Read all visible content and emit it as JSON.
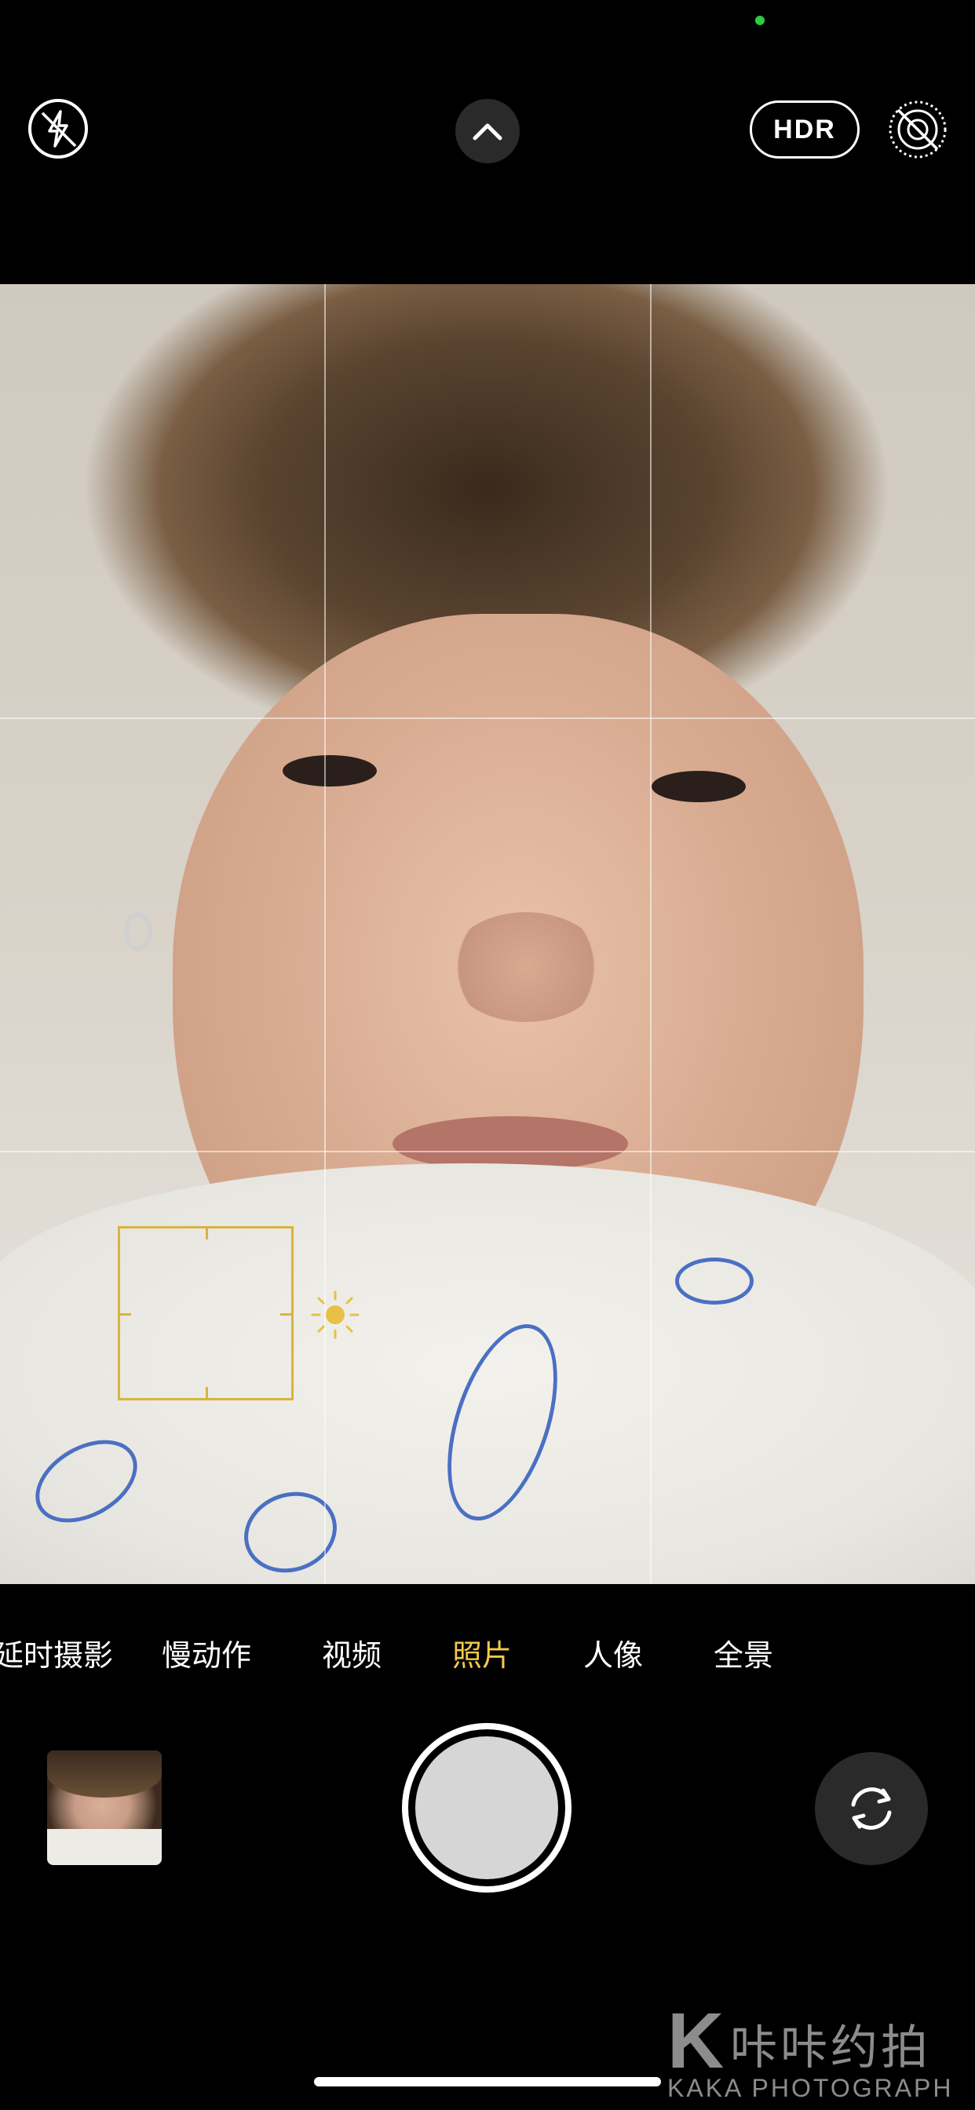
{
  "top_bar": {
    "flash_icon": "flash-off-icon",
    "expand_icon": "chevron-up-icon",
    "hdr_label": "HDR",
    "live_icon": "live-photo-off-icon"
  },
  "viewfinder": {
    "grid": true,
    "focus_color": "#d9b43c",
    "exposure_icon": "sun-icon"
  },
  "modes": {
    "items": [
      "延时摄影",
      "慢动作",
      "视频",
      "照片",
      "人像",
      "全景"
    ],
    "active": "照片",
    "active_color": "#f2c94c"
  },
  "bottom_bar": {
    "thumbnail_icon": "last-photo-thumbnail",
    "shutter_icon": "shutter-button",
    "switch_icon": "camera-flip-icon"
  },
  "watermark": {
    "mark": "K",
    "chinese": "咔咔约拍",
    "english": "KAKA PHOTOGRAPH"
  }
}
